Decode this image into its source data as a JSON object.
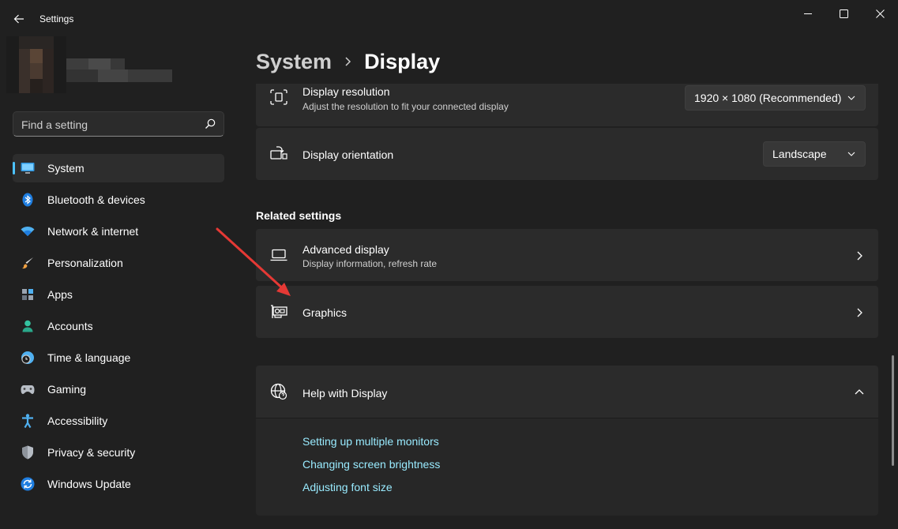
{
  "window": {
    "title": "Settings"
  },
  "search": {
    "placeholder": "Find a setting"
  },
  "sidebar": {
    "items": [
      {
        "label": "System",
        "icon": "monitor-icon",
        "active": true
      },
      {
        "label": "Bluetooth & devices",
        "icon": "bluetooth-icon"
      },
      {
        "label": "Network & internet",
        "icon": "wifi-icon"
      },
      {
        "label": "Personalization",
        "icon": "brush-icon"
      },
      {
        "label": "Apps",
        "icon": "apps-icon"
      },
      {
        "label": "Accounts",
        "icon": "person-icon"
      },
      {
        "label": "Time & language",
        "icon": "clock-globe-icon"
      },
      {
        "label": "Gaming",
        "icon": "gamepad-icon"
      },
      {
        "label": "Accessibility",
        "icon": "accessibility-icon"
      },
      {
        "label": "Privacy & security",
        "icon": "shield-icon"
      },
      {
        "label": "Windows Update",
        "icon": "update-icon"
      }
    ]
  },
  "breadcrumb": {
    "parent": "System",
    "current": "Display"
  },
  "main": {
    "resolution": {
      "title": "Display resolution",
      "subtitle": "Adjust the resolution to fit your connected display",
      "value": "1920 × 1080 (Recommended)"
    },
    "orientation": {
      "title": "Display orientation",
      "value": "Landscape"
    },
    "related_heading": "Related settings",
    "advanced": {
      "title": "Advanced display",
      "subtitle": "Display information, refresh rate"
    },
    "graphics": {
      "title": "Graphics"
    },
    "help": {
      "title": "Help with Display",
      "links": [
        "Setting up multiple monitors",
        "Changing screen brightness",
        "Adjusting font size"
      ]
    }
  },
  "colors": {
    "background": "#202020",
    "card": "#2b2b2b",
    "accent": "#4cc2ff",
    "link": "#99ebff",
    "annotation_arrow": "#e53935"
  }
}
